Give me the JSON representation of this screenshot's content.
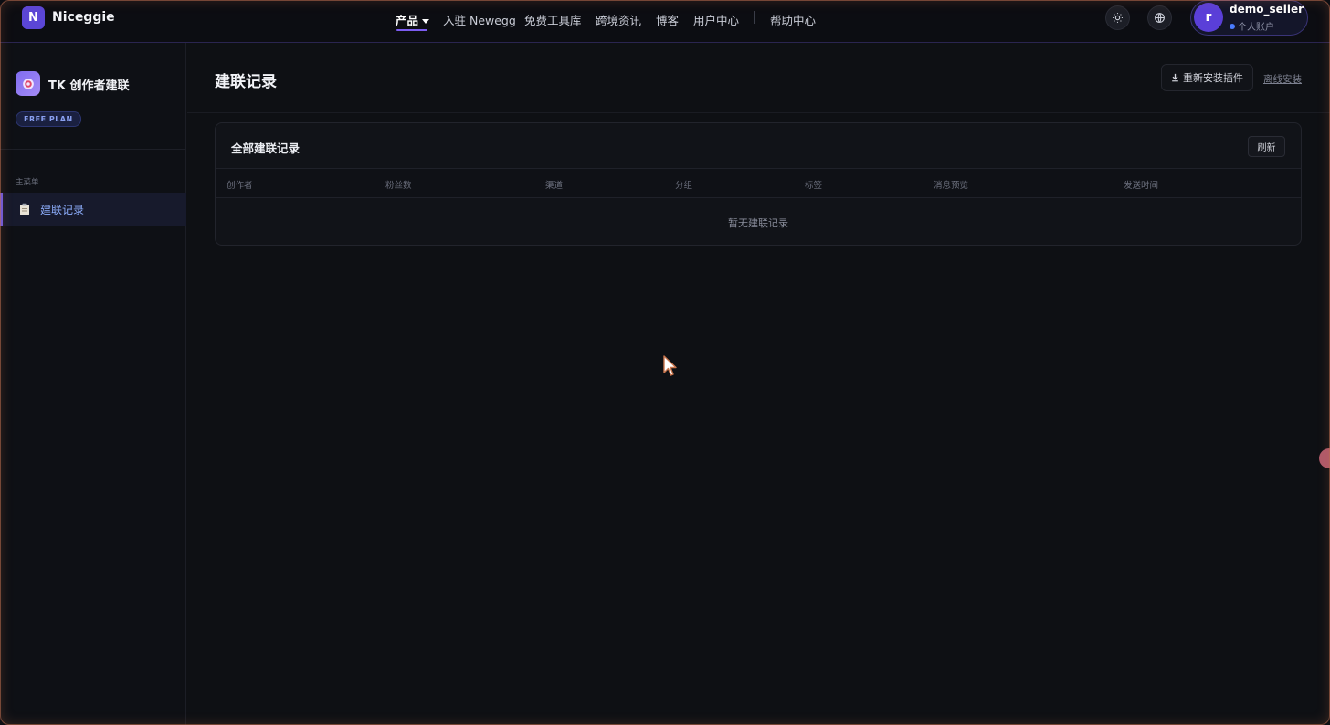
{
  "brand": {
    "logo_letter": "N",
    "name": "Niceggie"
  },
  "nav": {
    "items": [
      {
        "label": "产品",
        "active": true
      },
      {
        "label": "入驻 Newegg"
      },
      {
        "label": "免费工具库"
      },
      {
        "label": "跨境资讯"
      },
      {
        "label": "博客"
      },
      {
        "label": "用户中心"
      },
      {
        "label": "帮助中心"
      }
    ]
  },
  "header_icons": [
    "sun-icon",
    "globe-icon"
  ],
  "user": {
    "avatar_letter": "r",
    "name": "demo_seller",
    "account_type": "个人账户"
  },
  "sidebar": {
    "app_title": "TK 创作者建联",
    "plan": "FREE PLAN",
    "menu_heading": "主菜单",
    "items": [
      {
        "label": "建联记录",
        "icon": "clipboard-icon",
        "active": true
      }
    ]
  },
  "main": {
    "page_title": "建联记录",
    "reinstall_label": "重新安装插件",
    "offline_label": "离线安装",
    "card": {
      "title": "全部建联记录",
      "refresh_label": "刷新",
      "columns": [
        "创作者",
        "粉丝数",
        "渠道",
        "分组",
        "标签",
        "消息预览",
        "发送时间"
      ],
      "empty_text": "暂无建联记录"
    }
  },
  "colors": {
    "accent": "#7c5cf0",
    "active_link": "#8fb0ff",
    "background": "#0e1014"
  }
}
